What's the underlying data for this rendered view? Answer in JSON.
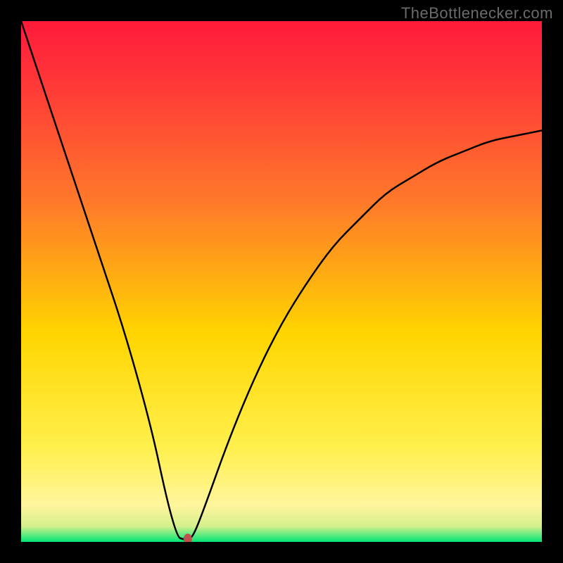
{
  "watermark": "TheBottlenecker.com",
  "chart_data": {
    "type": "line",
    "title": "",
    "xlabel": "",
    "ylabel": "",
    "xlim": [
      0,
      100
    ],
    "ylim": [
      0,
      100
    ],
    "background": {
      "top_color": "#ff1a3a",
      "mid_color": "#ffd500",
      "bottom_accent": "#00e676",
      "near_bottom": "#fff59d"
    },
    "curve": [
      {
        "x": 0,
        "y": 100
      },
      {
        "x": 5,
        "y": 85
      },
      {
        "x": 10,
        "y": 70
      },
      {
        "x": 15,
        "y": 55
      },
      {
        "x": 20,
        "y": 40
      },
      {
        "x": 25,
        "y": 22
      },
      {
        "x": 28,
        "y": 8
      },
      {
        "x": 30,
        "y": 1
      },
      {
        "x": 31,
        "y": 0.5
      },
      {
        "x": 32,
        "y": 0.5
      },
      {
        "x": 33,
        "y": 1
      },
      {
        "x": 35,
        "y": 6
      },
      {
        "x": 40,
        "y": 20
      },
      {
        "x": 45,
        "y": 32
      },
      {
        "x": 50,
        "y": 42
      },
      {
        "x": 55,
        "y": 50
      },
      {
        "x": 60,
        "y": 57
      },
      {
        "x": 65,
        "y": 62
      },
      {
        "x": 70,
        "y": 67
      },
      {
        "x": 75,
        "y": 70
      },
      {
        "x": 80,
        "y": 73
      },
      {
        "x": 85,
        "y": 75
      },
      {
        "x": 90,
        "y": 77
      },
      {
        "x": 95,
        "y": 78
      },
      {
        "x": 100,
        "y": 79
      }
    ],
    "marker": {
      "x": 32,
      "y": 0.5,
      "color": "#c0504d",
      "rx": 6,
      "ry": 8
    }
  }
}
